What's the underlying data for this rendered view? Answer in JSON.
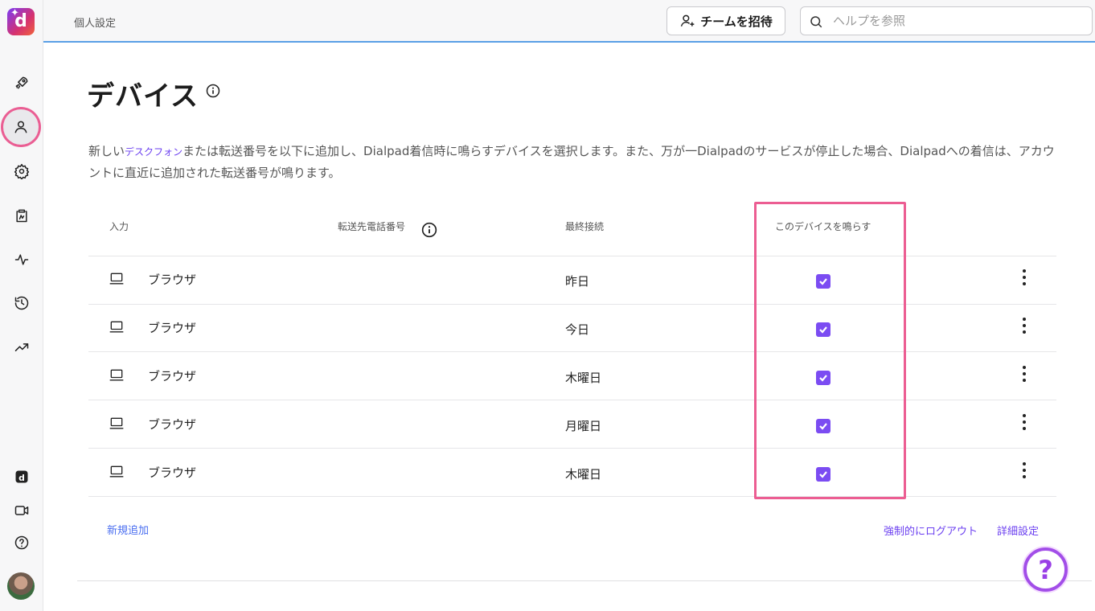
{
  "header": {
    "breadcrumb": "個人設定",
    "invite_label": "チームを招待",
    "search_placeholder": "ヘルプを参照"
  },
  "page": {
    "title": "デバイス",
    "desc_prefix": "新しい",
    "desc_link": "デスクフォン",
    "desc_suffix": "または転送番号を以下に追加し、Dialpad着信時に鳴らすデバイスを選択します。また、万が一Dialpadのサービスが停止した場合、Dialpadへの着信は、アカウントに直近に追加された転送番号が鳴ります。"
  },
  "table": {
    "headers": {
      "input": "入力",
      "forward_number": "転送先電話番号",
      "last_connected": "最終接続",
      "ring_device": "このデバイスを鳴らす"
    },
    "rows": [
      {
        "device": "ブラウザ",
        "last_connected": "昨日",
        "ring": true
      },
      {
        "device": "ブラウザ",
        "last_connected": "今日",
        "ring": true
      },
      {
        "device": "ブラウザ",
        "last_connected": "木曜日",
        "ring": true
      },
      {
        "device": "ブラウザ",
        "last_connected": "月曜日",
        "ring": true
      },
      {
        "device": "ブラウザ",
        "last_connected": "木曜日",
        "ring": true
      }
    ]
  },
  "footer": {
    "add_new": "新規追加",
    "force_logout": "強制的にログアウト",
    "advanced": "詳細設定"
  },
  "help_fab": "?",
  "logo_letter": "d",
  "colors": {
    "accent": "#7b4cf2",
    "highlight": "#ec5d92",
    "link": "#4a6ef0"
  }
}
